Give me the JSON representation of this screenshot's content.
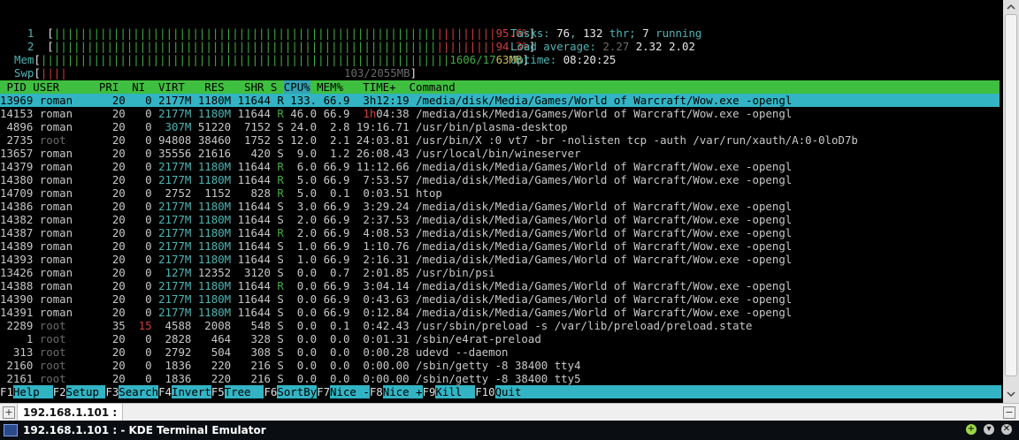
{
  "meters": {
    "cpu1": {
      "label": "1",
      "bar_green": "||||||||||||||||||||||||||||||||||||||||||||||||||||||||||",
      "bar_red": "|||||||||",
      "value": "95.6%"
    },
    "cpu2": {
      "label": "2",
      "bar_green": "||||||||||||||||||||||||||||||||||||||||||||||||||||||||||",
      "bar_red": "|||||||||",
      "value": "94.3%"
    },
    "mem": {
      "label": "Mem",
      "bar_green": "||||||||||||||||||||||||||||||||||||||||||||||||||||||||||||||",
      "value_used": "1606/17",
      "value_tail": "63MB"
    },
    "swp": {
      "label": "Swp",
      "bar_red": "||||",
      "value": "103/2055MB"
    }
  },
  "summary": {
    "tasks_label": "Tasks: ",
    "tasks": "76",
    "thr_sep": ", ",
    "thr": "132",
    "thr_label": " thr; ",
    "running": "7",
    "running_label": " running",
    "load_label": "Load average: ",
    "load1": "2.27",
    "load5": "2.32",
    "load15": "2.02",
    "uptime_label": "Uptime: ",
    "uptime": "08:20:25"
  },
  "header": {
    "pre": " PID USER      PRI  NI  VIRT   RES   SHR S ",
    "sort": "CPU%",
    "post": " MEM%   TIME+  Command"
  },
  "processes": [
    {
      "pid": "13969",
      "user": "roman",
      "pri": "20",
      "ni": "0",
      "virt": "2177M",
      "res": "1180M",
      "shr": "11644",
      "s": "R",
      "cpu": "133.",
      "mem": "66.9",
      "time": "3h12:19",
      "cmd": "/media/disk/Media/Games/World of Warcraft/Wow.exe -opengl",
      "selected": true
    },
    {
      "pid": "14153",
      "user": "roman",
      "pri": "20",
      "ni": "0",
      "virt": "2177M",
      "res": "1180M",
      "shr": "11644",
      "s": "R",
      "cpu": "46.0",
      "mem": "66.9",
      "time": "1h04:38",
      "cmd": "/media/disk/Media/Games/World of Warcraft/Wow.exe -opengl"
    },
    {
      "pid": "4896",
      "user": "roman",
      "pri": "20",
      "ni": "0",
      "virt": "307M",
      "res": "51220",
      "shr": "7152",
      "s": "S",
      "cpu": "24.0",
      "mem": "2.8",
      "time": "19:16.71",
      "cmd": "/usr/bin/plasma-desktop"
    },
    {
      "pid": "2735",
      "user": "root",
      "pri": "20",
      "ni": "0",
      "virt": "94808",
      "res": "38460",
      "shr": "1752",
      "s": "S",
      "cpu": "12.0",
      "mem": "2.1",
      "time": "24:03.81",
      "cmd": "/usr/bin/X :0 vt7 -br -nolisten tcp -auth /var/run/xauth/A:0-0loD7b"
    },
    {
      "pid": "13657",
      "user": "roman",
      "pri": "20",
      "ni": "0",
      "virt": "35556",
      "res": "21616",
      "shr": "420",
      "s": "S",
      "cpu": "9.0",
      "mem": "1.2",
      "time": "26:08.43",
      "cmd": "/usr/local/bin/wineserver"
    },
    {
      "pid": "14379",
      "user": "roman",
      "pri": "20",
      "ni": "0",
      "virt": "2177M",
      "res": "1180M",
      "shr": "11644",
      "s": "R",
      "cpu": "6.0",
      "mem": "66.9",
      "time": "11:12.66",
      "cmd": "/media/disk/Media/Games/World of Warcraft/Wow.exe -opengl"
    },
    {
      "pid": "14380",
      "user": "roman",
      "pri": "20",
      "ni": "0",
      "virt": "2177M",
      "res": "1180M",
      "shr": "11644",
      "s": "R",
      "cpu": "5.0",
      "mem": "66.9",
      "time": "7:53.57",
      "cmd": "/media/disk/Media/Games/World of Warcraft/Wow.exe -opengl"
    },
    {
      "pid": "14709",
      "user": "roman",
      "pri": "20",
      "ni": "0",
      "virt": "2752",
      "res": "1152",
      "shr": "828",
      "s": "R",
      "cpu": "5.0",
      "mem": "0.1",
      "time": "0:03.51",
      "cmd": "htop"
    },
    {
      "pid": "14386",
      "user": "roman",
      "pri": "20",
      "ni": "0",
      "virt": "2177M",
      "res": "1180M",
      "shr": "11644",
      "s": "S",
      "cpu": "3.0",
      "mem": "66.9",
      "time": "3:29.24",
      "cmd": "/media/disk/Media/Games/World of Warcraft/Wow.exe -opengl"
    },
    {
      "pid": "14382",
      "user": "roman",
      "pri": "20",
      "ni": "0",
      "virt": "2177M",
      "res": "1180M",
      "shr": "11644",
      "s": "S",
      "cpu": "2.0",
      "mem": "66.9",
      "time": "2:37.53",
      "cmd": "/media/disk/Media/Games/World of Warcraft/Wow.exe -opengl"
    },
    {
      "pid": "14387",
      "user": "roman",
      "pri": "20",
      "ni": "0",
      "virt": "2177M",
      "res": "1180M",
      "shr": "11644",
      "s": "R",
      "cpu": "2.0",
      "mem": "66.9",
      "time": "4:08.53",
      "cmd": "/media/disk/Media/Games/World of Warcraft/Wow.exe -opengl"
    },
    {
      "pid": "14389",
      "user": "roman",
      "pri": "20",
      "ni": "0",
      "virt": "2177M",
      "res": "1180M",
      "shr": "11644",
      "s": "S",
      "cpu": "1.0",
      "mem": "66.9",
      "time": "1:10.76",
      "cmd": "/media/disk/Media/Games/World of Warcraft/Wow.exe -opengl"
    },
    {
      "pid": "14393",
      "user": "roman",
      "pri": "20",
      "ni": "0",
      "virt": "2177M",
      "res": "1180M",
      "shr": "11644",
      "s": "S",
      "cpu": "1.0",
      "mem": "66.9",
      "time": "2:16.31",
      "cmd": "/media/disk/Media/Games/World of Warcraft/Wow.exe -opengl"
    },
    {
      "pid": "13426",
      "user": "roman",
      "pri": "20",
      "ni": "0",
      "virt": "127M",
      "res": "12352",
      "shr": "3120",
      "s": "S",
      "cpu": "0.0",
      "mem": "0.7",
      "time": "2:01.85",
      "cmd": "/usr/bin/psi"
    },
    {
      "pid": "14388",
      "user": "roman",
      "pri": "20",
      "ni": "0",
      "virt": "2177M",
      "res": "1180M",
      "shr": "11644",
      "s": "R",
      "cpu": "0.0",
      "mem": "66.9",
      "time": "3:04.14",
      "cmd": "/media/disk/Media/Games/World of Warcraft/Wow.exe -opengl"
    },
    {
      "pid": "14390",
      "user": "roman",
      "pri": "20",
      "ni": "0",
      "virt": "2177M",
      "res": "1180M",
      "shr": "11644",
      "s": "S",
      "cpu": "0.0",
      "mem": "66.9",
      "time": "0:43.63",
      "cmd": "/media/disk/Media/Games/World of Warcraft/Wow.exe -opengl"
    },
    {
      "pid": "14391",
      "user": "roman",
      "pri": "20",
      "ni": "0",
      "virt": "2177M",
      "res": "1180M",
      "shr": "11644",
      "s": "S",
      "cpu": "0.0",
      "mem": "66.9",
      "time": "0:12.84",
      "cmd": "/media/disk/Media/Games/World of Warcraft/Wow.exe -opengl"
    },
    {
      "pid": "2289",
      "user": "root",
      "pri": "35",
      "ni": "15",
      "virt": "4588",
      "res": "2008",
      "shr": "548",
      "s": "S",
      "cpu": "0.0",
      "mem": "0.1",
      "time": "0:42.43",
      "cmd": "/usr/sbin/preload -s /var/lib/preload/preload.state"
    },
    {
      "pid": "1",
      "user": "root",
      "pri": "20",
      "ni": "0",
      "virt": "2828",
      "res": "464",
      "shr": "328",
      "s": "S",
      "cpu": "0.0",
      "mem": "0.0",
      "time": "0:01.31",
      "cmd": "/sbin/e4rat-preload"
    },
    {
      "pid": "313",
      "user": "root",
      "pri": "20",
      "ni": "0",
      "virt": "2792",
      "res": "504",
      "shr": "308",
      "s": "S",
      "cpu": "0.0",
      "mem": "0.0",
      "time": "0:00.28",
      "cmd": "udevd --daemon"
    },
    {
      "pid": "2160",
      "user": "root",
      "pri": "20",
      "ni": "0",
      "virt": "1836",
      "res": "220",
      "shr": "216",
      "s": "S",
      "cpu": "0.0",
      "mem": "0.0",
      "time": "0:00.00",
      "cmd": "/sbin/getty -8 38400 tty4"
    },
    {
      "pid": "2161",
      "user": "root",
      "pri": "20",
      "ni": "0",
      "virt": "1836",
      "res": "220",
      "shr": "216",
      "s": "S",
      "cpu": "0.0",
      "mem": "0.0",
      "time": "0:00.00",
      "cmd": "/sbin/getty -8 38400 tty5"
    }
  ],
  "function_keys": [
    {
      "key": "F1",
      "label": "Help  "
    },
    {
      "key": "F2",
      "label": "Setup "
    },
    {
      "key": "F3",
      "label": "Search"
    },
    {
      "key": "F4",
      "label": "Invert"
    },
    {
      "key": "F5",
      "label": "Tree  "
    },
    {
      "key": "F6",
      "label": "SortBy"
    },
    {
      "key": "F7",
      "label": "Nice -"
    },
    {
      "key": "F8",
      "label": "Nice +"
    },
    {
      "key": "F9",
      "label": "Kill  "
    },
    {
      "key": "F10",
      "label": "Quit  "
    }
  ],
  "tab": {
    "label": "192.168.1.101 :"
  },
  "window": {
    "title": "192.168.1.101 : - KDE Terminal Emulator"
  },
  "colors": {
    "cyan": "#32b4c4",
    "green": "#3fbf3f",
    "red": "#d23c3c",
    "header_bg": "#3fbf3f"
  }
}
